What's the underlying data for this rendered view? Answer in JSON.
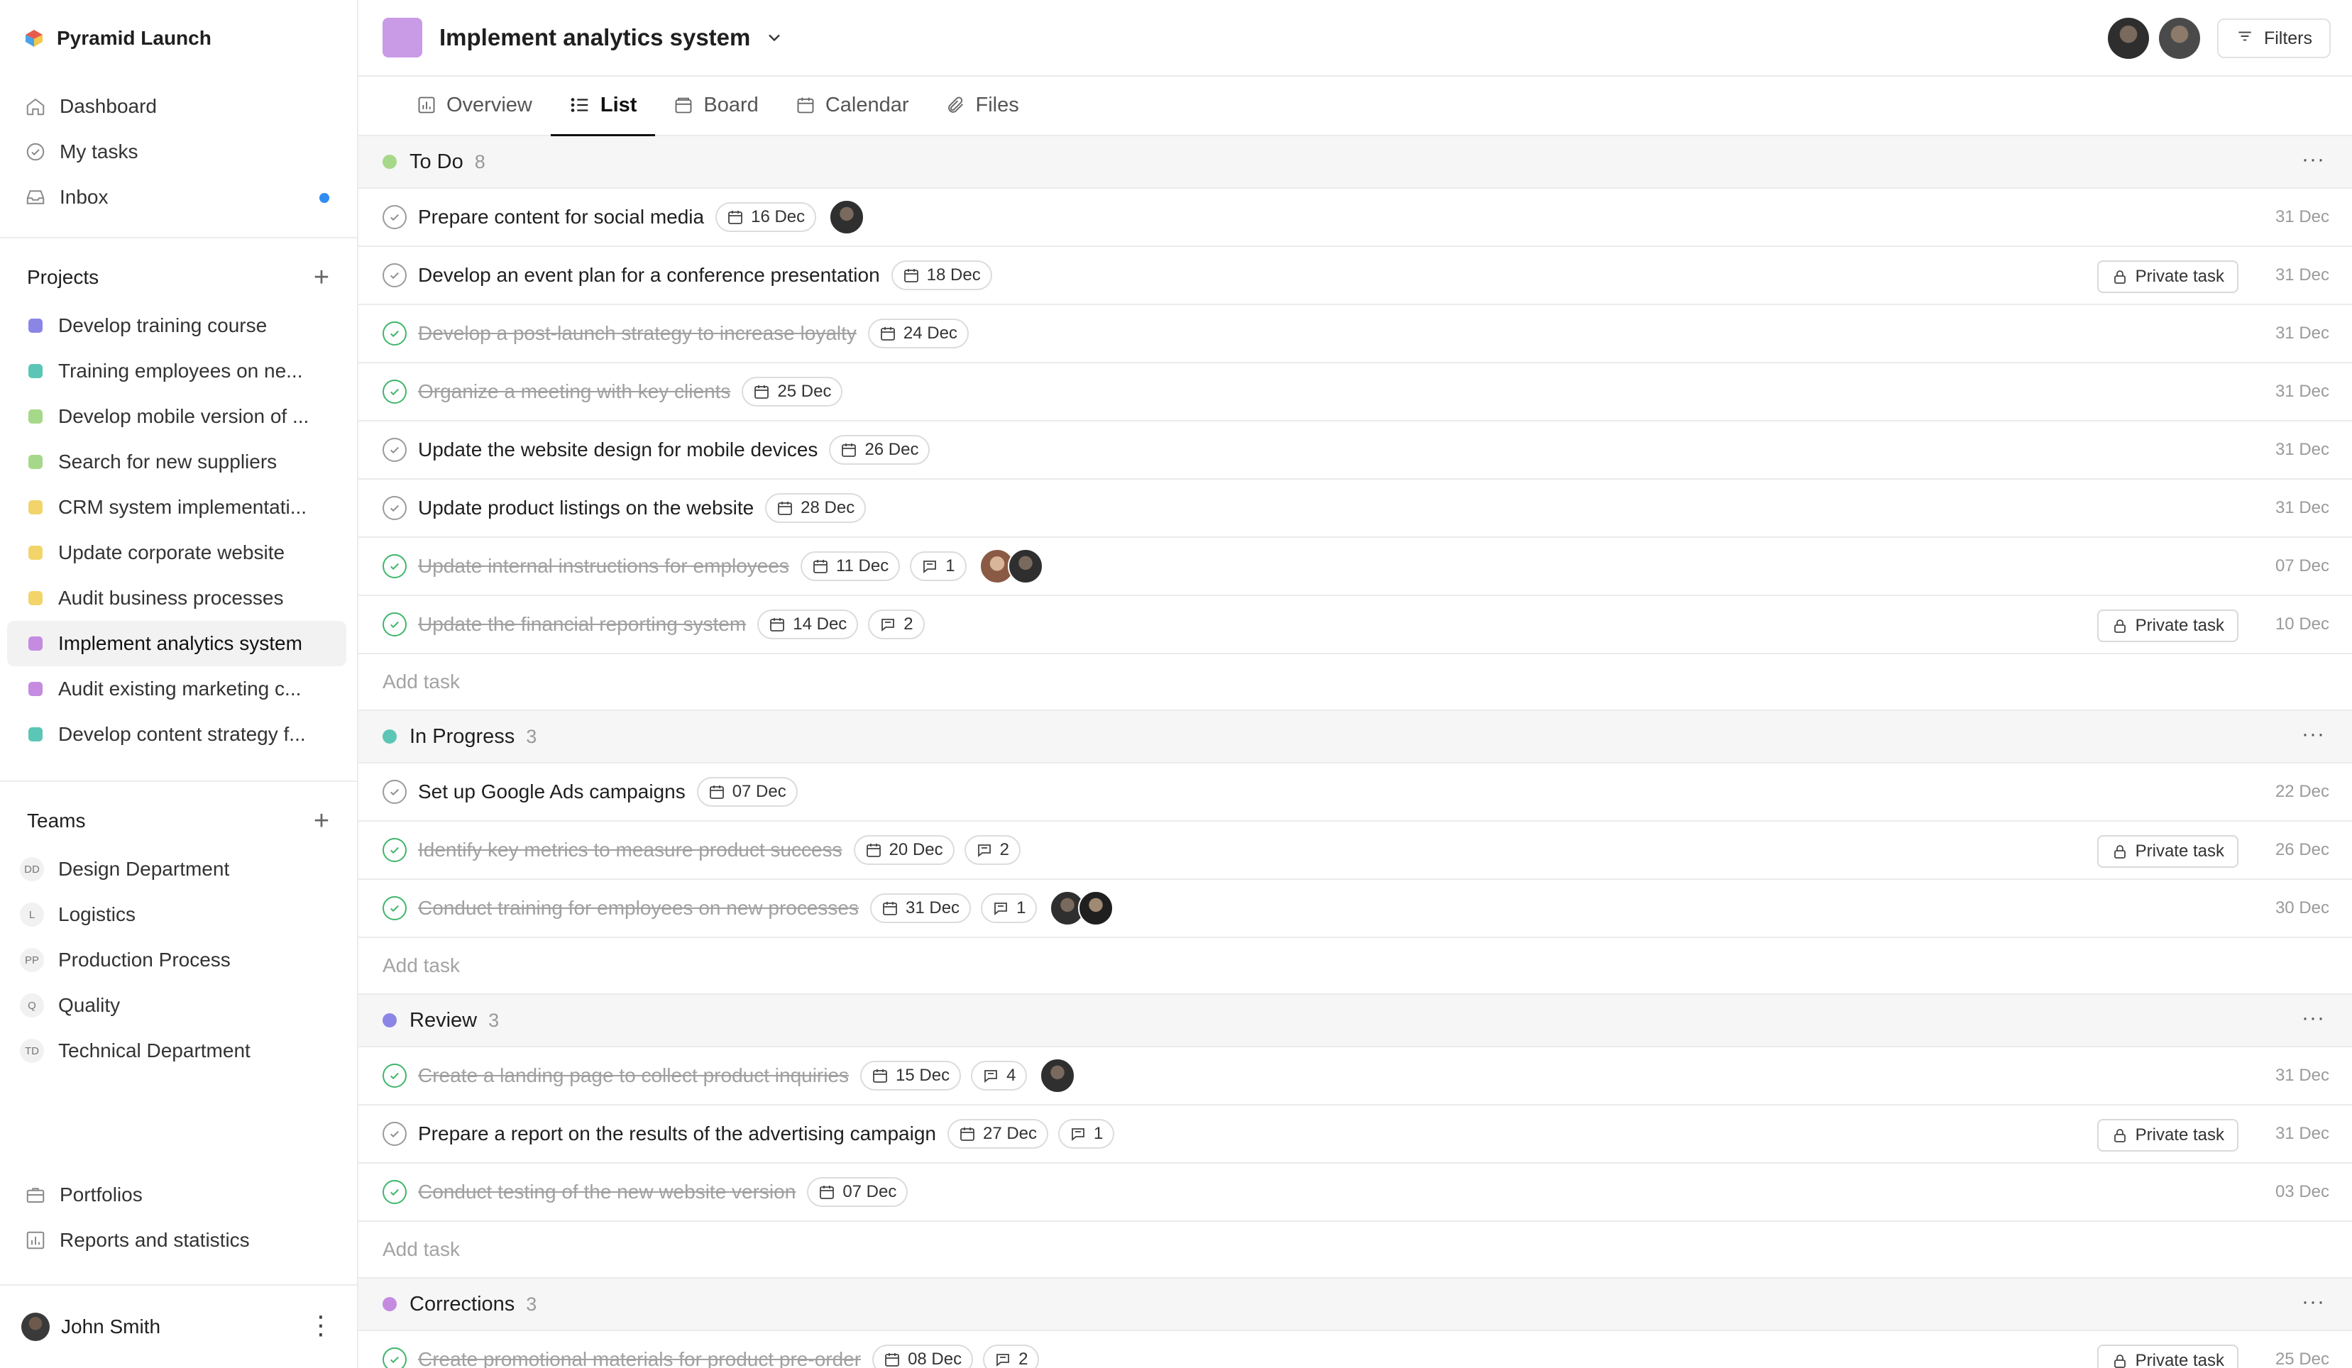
{
  "brand": {
    "name": "Pyramid Launch"
  },
  "nav": [
    {
      "label": "Dashboard",
      "icon": "home-icon"
    },
    {
      "label": "My tasks",
      "icon": "check-circle-icon"
    },
    {
      "label": "Inbox",
      "icon": "inbox-icon",
      "unread": true
    }
  ],
  "projects_section": {
    "title": "Projects"
  },
  "projects": [
    {
      "label": "Develop training course",
      "color": "#8b86e6"
    },
    {
      "label": "Training employees on ne...",
      "color": "#5cc6b6"
    },
    {
      "label": "Develop mobile version of ...",
      "color": "#a6d889"
    },
    {
      "label": "Search for new suppliers",
      "color": "#a6d889"
    },
    {
      "label": "CRM system implementati...",
      "color": "#f2d46b"
    },
    {
      "label": "Update corporate website",
      "color": "#f2d46b"
    },
    {
      "label": "Audit business processes",
      "color": "#f2d46b"
    },
    {
      "label": "Implement analytics system",
      "color": "#c48be0",
      "active": true
    },
    {
      "label": "Audit existing marketing c...",
      "color": "#c48be0"
    },
    {
      "label": "Develop content strategy f...",
      "color": "#5cc6b6"
    }
  ],
  "teams_section": {
    "title": "Teams"
  },
  "teams": [
    {
      "badge": "DD",
      "label": "Design Department"
    },
    {
      "badge": "L",
      "label": "Logistics"
    },
    {
      "badge": "PP",
      "label": "Production Process"
    },
    {
      "badge": "Q",
      "label": "Quality"
    },
    {
      "badge": "TD",
      "label": "Technical Department"
    }
  ],
  "bottom_nav": [
    {
      "label": "Portfolios",
      "icon": "briefcase-icon"
    },
    {
      "label": "Reports and statistics",
      "icon": "bar-chart-icon"
    }
  ],
  "user": {
    "name": "John Smith"
  },
  "header": {
    "title": "Implement analytics system",
    "filters_label": "Filters",
    "project_color": "#c99ae6"
  },
  "tabs": [
    {
      "label": "Overview",
      "icon": "chart-icon"
    },
    {
      "label": "List",
      "icon": "list-icon",
      "active": true
    },
    {
      "label": "Board",
      "icon": "board-icon"
    },
    {
      "label": "Calendar",
      "icon": "calendar-icon"
    },
    {
      "label": "Files",
      "icon": "paperclip-icon"
    }
  ],
  "add_task_label": "Add task",
  "private_label": "Private task",
  "groups": [
    {
      "name": "To Do",
      "count": "8",
      "color": "#a6d889",
      "tasks": [
        {
          "title": "Prepare content for social media",
          "done": false,
          "due": "16 Dec",
          "avatars": [
            "dark"
          ],
          "date": "31 Dec"
        },
        {
          "title": "Develop an event plan for a conference presentation",
          "done": false,
          "due": "18 Dec",
          "private": true,
          "date": "31 Dec"
        },
        {
          "title": "Develop a post-launch strategy to increase loyalty",
          "done": true,
          "due": "24 Dec",
          "date": "31 Dec"
        },
        {
          "title": "Organize a meeting with key clients",
          "done": true,
          "due": "25 Dec",
          "date": "31 Dec"
        },
        {
          "title": "Update the website design for mobile devices",
          "done": false,
          "due": "26 Dec",
          "date": "31 Dec"
        },
        {
          "title": "Update product listings on the website",
          "done": false,
          "due": "28 Dec",
          "date": "31 Dec"
        },
        {
          "title": "Update internal instructions for employees",
          "done": true,
          "due": "11 Dec",
          "comments": "1",
          "avatars": [
            "warm",
            "dark"
          ],
          "date": "07 Dec"
        },
        {
          "title": "Update the financial reporting system",
          "done": true,
          "due": "14 Dec",
          "comments": "2",
          "private": true,
          "date": "10 Dec"
        }
      ]
    },
    {
      "name": "In Progress",
      "count": "3",
      "color": "#5cc6b6",
      "tasks": [
        {
          "title": "Set up Google Ads campaigns",
          "done": false,
          "due": "07 Dec",
          "date": "22 Dec"
        },
        {
          "title": "Identify key metrics to measure product success",
          "done": true,
          "due": "20 Dec",
          "comments": "2",
          "private": true,
          "date": "26 Dec"
        },
        {
          "title": "Conduct training for employees on new processes",
          "done": true,
          "due": "31 Dec",
          "comments": "1",
          "avatars": [
            "dark",
            "dark2"
          ],
          "date": "30 Dec"
        }
      ]
    },
    {
      "name": "Review",
      "count": "3",
      "color": "#8b86e6",
      "tasks": [
        {
          "title": "Create a landing page to collect product inquiries",
          "done": true,
          "due": "15 Dec",
          "comments": "4",
          "avatars": [
            "dark"
          ],
          "date": "31 Dec"
        },
        {
          "title": "Prepare a report on the results of the advertising campaign",
          "done": false,
          "due": "27 Dec",
          "comments": "1",
          "private": true,
          "date": "31 Dec"
        },
        {
          "title": "Conduct testing of the new website version",
          "done": true,
          "due": "07 Dec",
          "date": "03 Dec"
        }
      ]
    },
    {
      "name": "Corrections",
      "count": "3",
      "color": "#c48be0",
      "tasks": [
        {
          "title": "Create promotional materials for product pre-order",
          "done": true,
          "due": "08 Dec",
          "comments": "2",
          "private": true,
          "date": "25 Dec"
        }
      ]
    }
  ]
}
